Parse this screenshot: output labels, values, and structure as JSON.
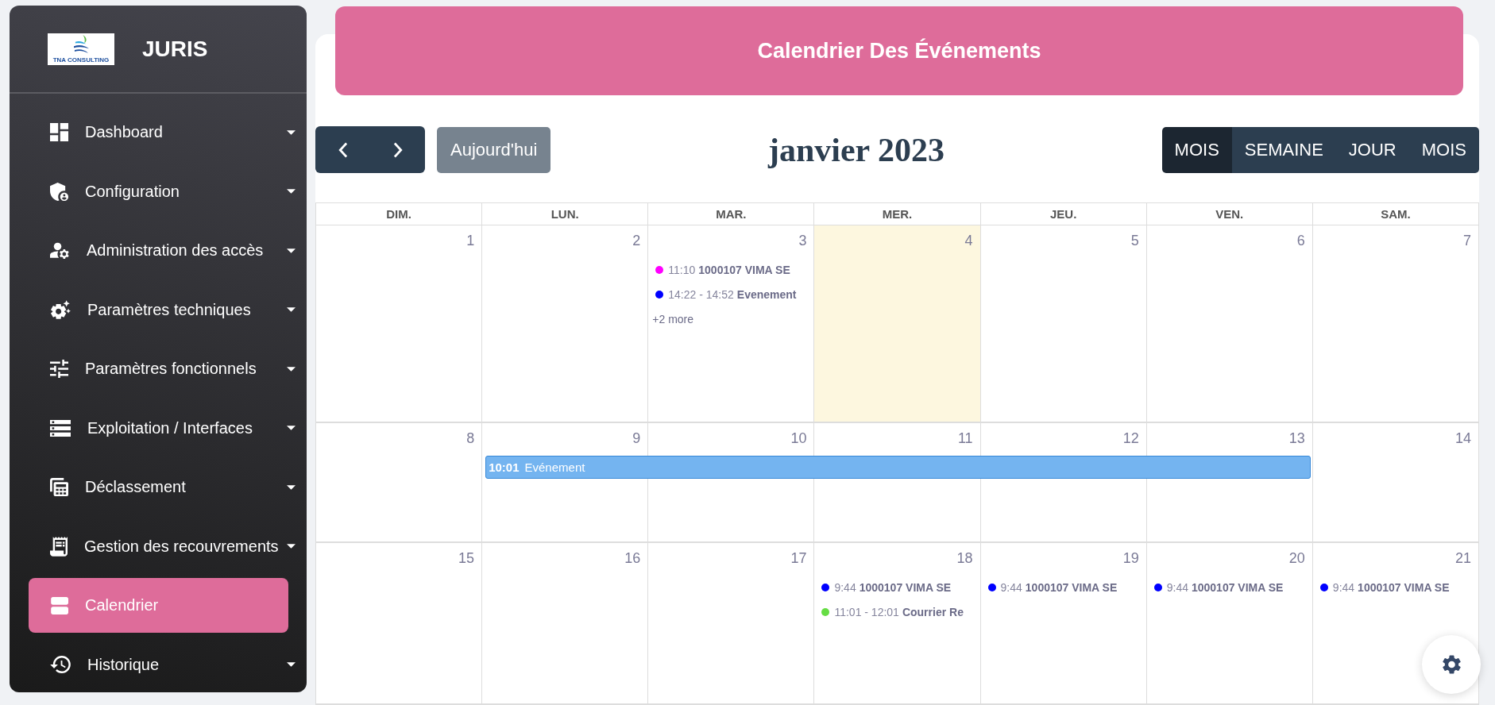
{
  "sidebar": {
    "logo_text": "TNA CONSULTING",
    "brand": "JURIS",
    "items": [
      {
        "label": "Dashboard",
        "selected": false,
        "expandable": true
      },
      {
        "label": "Configuration",
        "selected": false,
        "expandable": true
      },
      {
        "label": "Administration des accès",
        "selected": false,
        "expandable": true
      },
      {
        "label": "Paramètres techniques",
        "selected": false,
        "expandable": true
      },
      {
        "label": "Paramètres fonctionnels",
        "selected": false,
        "expandable": true
      },
      {
        "label": "Exploitation / Interfaces",
        "selected": false,
        "expandable": true
      },
      {
        "label": "Déclassement",
        "selected": false,
        "expandable": true
      },
      {
        "label": "Gestion des recouvrements",
        "selected": false,
        "expandable": true
      },
      {
        "label": "Calendrier",
        "selected": true,
        "expandable": false
      },
      {
        "label": "Historique",
        "selected": false,
        "expandable": true
      }
    ]
  },
  "banner": {
    "title": "Calendrier Des Événements"
  },
  "toolbar": {
    "today_button": {
      "label": "Aujourd'hui",
      "disabled": true
    },
    "title": "janvier 2023",
    "views": [
      {
        "label": "MOIS",
        "selected": true
      },
      {
        "label": "SEMAINE",
        "selected": false
      },
      {
        "label": "JOUR",
        "selected": false
      },
      {
        "label": "MOIS",
        "selected": false
      }
    ]
  },
  "calendar": {
    "weekdays": [
      "DIM.",
      "LUN.",
      "MAR.",
      "MER.",
      "JEU.",
      "VEN.",
      "SAM."
    ],
    "weeks": [
      {
        "days": [
          {
            "number": "1",
            "today": false
          },
          {
            "number": "2",
            "today": false
          },
          {
            "number": "3",
            "today": false,
            "events": [
              {
                "kind": "dot",
                "time": "11:10",
                "title": "1000107 VIMA SE",
                "color": "#ff00ff"
              },
              {
                "kind": "dot",
                "time": "14:22 - 14:52",
                "title": "Evenement",
                "color": "#0000ff"
              }
            ],
            "more": "+2 more"
          },
          {
            "number": "4",
            "today": true
          },
          {
            "number": "5",
            "today": false
          },
          {
            "number": "6",
            "today": false
          },
          {
            "number": "7",
            "today": false
          }
        ]
      },
      {
        "days": [
          {
            "number": "8",
            "today": false
          },
          {
            "number": "9",
            "today": false,
            "events": [
              {
                "kind": "bar",
                "time": "10:01",
                "title": "Evénement",
                "color": "#74b4f0"
              }
            ]
          },
          {
            "number": "10",
            "today": false,
            "bar_continues": true
          },
          {
            "number": "11",
            "today": false,
            "bar_continues": true
          },
          {
            "number": "12",
            "today": false,
            "bar_continues": true
          },
          {
            "number": "13",
            "today": false,
            "bar_continues": true
          },
          {
            "number": "14",
            "today": false
          }
        ]
      },
      {
        "days": [
          {
            "number": "15",
            "today": false
          },
          {
            "number": "16",
            "today": false
          },
          {
            "number": "17",
            "today": false
          },
          {
            "number": "18",
            "today": false,
            "events": [
              {
                "kind": "dot",
                "time": "9:44",
                "title": "1000107 VIMA SE",
                "color": "#0000ff"
              },
              {
                "kind": "dot",
                "time": "11:01 - 12:01",
                "title": "Courrier Re",
                "color": "#66dd44"
              }
            ]
          },
          {
            "number": "19",
            "today": false,
            "events": [
              {
                "kind": "dot",
                "time": "9:44",
                "title": "1000107 VIMA SE",
                "color": "#0000ff"
              }
            ]
          },
          {
            "number": "20",
            "today": false,
            "events": [
              {
                "kind": "dot",
                "time": "9:44",
                "title": "1000107 VIMA SE",
                "color": "#0000ff"
              }
            ]
          },
          {
            "number": "21",
            "today": false,
            "events": [
              {
                "kind": "dot",
                "time": "9:44",
                "title": "1000107 VIMA SE",
                "color": "#0000ff"
              }
            ]
          }
        ]
      }
    ]
  }
}
